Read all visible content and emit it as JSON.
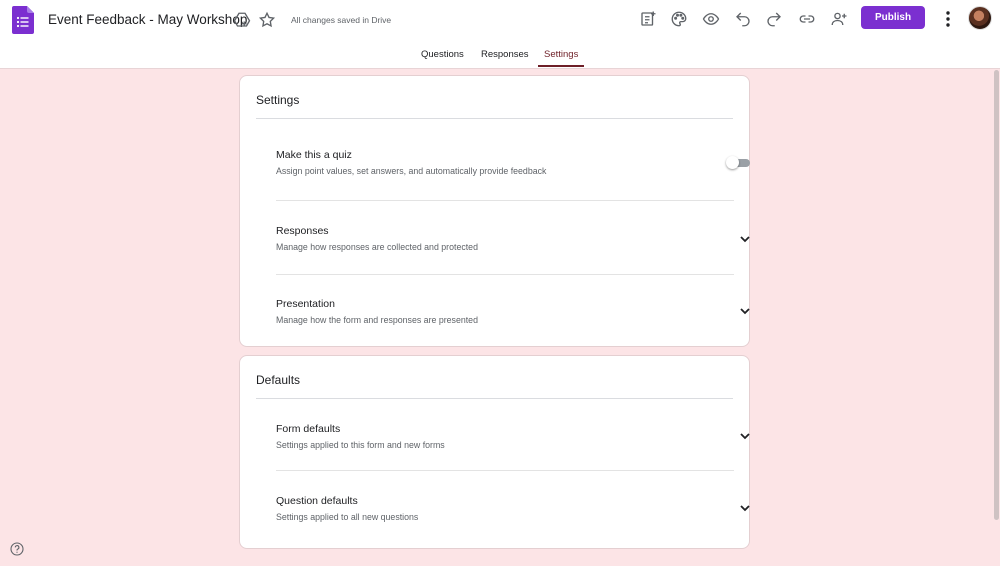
{
  "header": {
    "title": "Event Feedback - May Workshop",
    "save_status": "All changes saved in Drive",
    "publish_label": "Publish",
    "accent_color": "#7b2fd0"
  },
  "tabs": [
    {
      "label": "Questions",
      "active": false
    },
    {
      "label": "Responses",
      "active": false
    },
    {
      "label": "Settings",
      "active": true
    }
  ],
  "settings_card": {
    "title": "Settings",
    "rows": [
      {
        "title": "Make this a quiz",
        "description": "Assign point values, set answers, and automatically provide feedback",
        "control": "toggle",
        "toggle_on": false
      },
      {
        "title": "Responses",
        "description": "Manage how responses are collected and protected",
        "control": "chevron"
      },
      {
        "title": "Presentation",
        "description": "Manage how the form and responses are presented",
        "control": "chevron"
      }
    ]
  },
  "defaults_card": {
    "title": "Defaults",
    "rows": [
      {
        "title": "Form defaults",
        "description": "Settings applied to this form and new forms",
        "control": "chevron"
      },
      {
        "title": "Question defaults",
        "description": "Settings applied to all new questions",
        "control": "chevron"
      }
    ]
  },
  "icons": [
    "forms-logo-icon",
    "move-to-drive-icon",
    "star-icon",
    "add-on-icon",
    "palette-icon",
    "preview-eye-icon",
    "undo-icon",
    "redo-icon",
    "link-icon",
    "add-collaborator-icon",
    "more-vert-icon",
    "help-icon",
    "chevron-down-icon"
  ]
}
